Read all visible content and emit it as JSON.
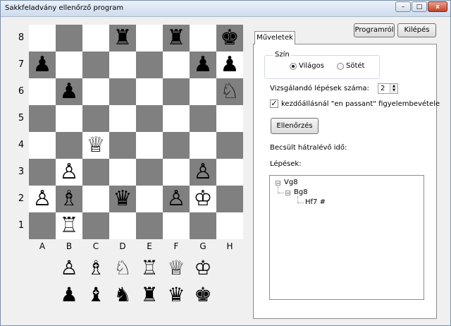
{
  "window": {
    "title": "Sakkfeladvány ellenőrző program",
    "controls": {
      "minimize": "–",
      "maximize": "□",
      "close": "x"
    }
  },
  "board": {
    "ranks": [
      "8",
      "7",
      "6",
      "5",
      "4",
      "3",
      "2",
      "1"
    ],
    "files": [
      "A",
      "B",
      "C",
      "D",
      "E",
      "F",
      "G",
      "H"
    ],
    "squares": [
      [
        "",
        "",
        "",
        "♜",
        "",
        "♜",
        "",
        "♚"
      ],
      [
        "♟",
        "",
        "",
        "",
        "",
        "",
        "♟",
        "♟"
      ],
      [
        "",
        "♟",
        "",
        "",
        "",
        "",
        "",
        "♘"
      ],
      [
        "",
        "",
        "",
        "",
        "",
        "",
        "",
        ""
      ],
      [
        "",
        "",
        "♕",
        "",
        "",
        "",
        "",
        ""
      ],
      [
        "",
        "♙",
        "",
        "",
        "",
        "",
        "♙",
        ""
      ],
      [
        "♙",
        "♗",
        "",
        "♛",
        "",
        "♙",
        "♔",
        ""
      ],
      [
        "",
        "♖",
        "",
        "",
        "",
        "",
        "",
        ""
      ]
    ],
    "colors": {
      "light": "#ffffff",
      "dark": "#808080"
    }
  },
  "palette": {
    "white": [
      "♙",
      "♗",
      "♘",
      "♖",
      "♕",
      "♔"
    ],
    "black": [
      "♟",
      "♝",
      "♞",
      "♜",
      "♛",
      "♚"
    ]
  },
  "buttons": {
    "about": "Programról",
    "exit": "Kilépés",
    "check": "Ellenőrzés"
  },
  "tabs": [
    {
      "label": "Műveletek"
    }
  ],
  "panel": {
    "color_group_title": "Szín",
    "light_option": "Világos",
    "dark_option": "Sötét",
    "selected_color": "Világos",
    "moves_label": "Vizsgálandó lépések száma:",
    "moves_value": "2",
    "en_passant_label": "kezdőállásnál \"en passant\" figyelembevétele",
    "en_passant_checked": true,
    "remaining_time_label": "Becsült hátralévő idő:",
    "moves_tree_label": "Lépések:"
  },
  "tree": {
    "root": {
      "label": "Vg8",
      "expander": "−"
    },
    "child": {
      "label": "Bg8",
      "expander": "−"
    },
    "leaf": {
      "label": "Hf7 #"
    }
  }
}
